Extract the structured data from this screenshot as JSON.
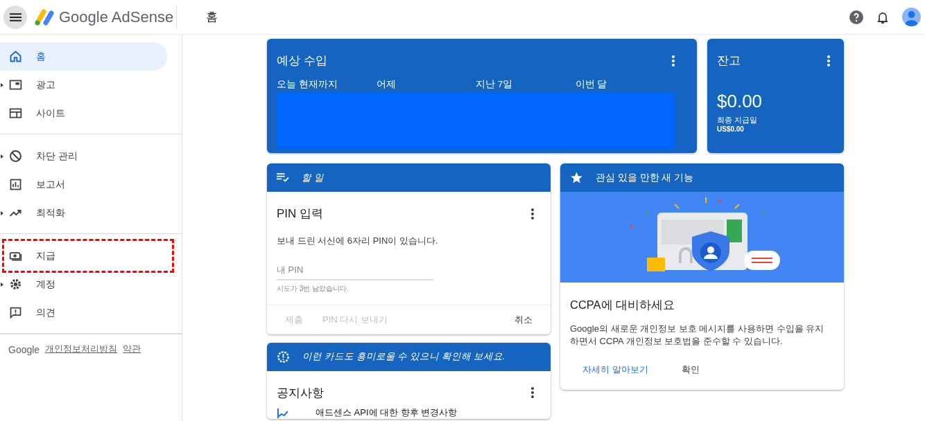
{
  "header": {
    "product": "Google AdSense",
    "page_title": "홈"
  },
  "sidebar": {
    "groups": [
      [
        {
          "label": "홈",
          "selected": true,
          "expandable": false,
          "annotated": false
        },
        {
          "label": "광고",
          "selected": false,
          "expandable": true,
          "annotated": false
        },
        {
          "label": "사이트",
          "selected": false,
          "expandable": false,
          "annotated": false
        }
      ],
      [
        {
          "label": "차단 관리",
          "selected": false,
          "expandable": true,
          "annotated": false
        },
        {
          "label": "보고서",
          "selected": false,
          "expandable": false,
          "annotated": false
        },
        {
          "label": "최적화",
          "selected": false,
          "expandable": true,
          "annotated": false
        }
      ],
      [
        {
          "label": "지급",
          "selected": false,
          "expandable": false,
          "annotated": true
        },
        {
          "label": "계정",
          "selected": false,
          "expandable": true,
          "annotated": false
        },
        {
          "label": "의견",
          "selected": false,
          "expandable": false,
          "annotated": false
        }
      ]
    ],
    "footer": {
      "brand": "Google",
      "links": [
        "개인정보처리방침",
        "약관"
      ]
    }
  },
  "earnings": {
    "title": "예상 수입",
    "columns": [
      "오늘 현재까지",
      "어제",
      "지난 7일",
      "이번 달"
    ]
  },
  "balance": {
    "title": "잔고",
    "amount": "$0.00",
    "last_payment_label": "최종 지급일",
    "last_payment": "US$0.00"
  },
  "todo": {
    "header": "할 일",
    "title": "PIN 입력",
    "text": "보내 드린 서신에 6자리 PIN이 있습니다.",
    "input": {
      "placeholder": "내 PIN",
      "helper": "시도가 3번 남았습니다."
    },
    "actions": [
      {
        "label": "제출",
        "disabled": true
      },
      {
        "label": "PIN 다시 보내기",
        "disabled": true
      },
      {
        "label": "취소",
        "disabled": false
      }
    ]
  },
  "suggestion": {
    "header": "이런 카드도 흥미로울 수 있으니 확인해 보세요.",
    "title": "공지사항",
    "items": [
      "애드센스 API에 대한 향후 변경사항"
    ]
  },
  "feature": {
    "header": "관심 있을 만한 새 기능",
    "title": "CCPA에 대비하세요",
    "text": "Google의 새로운 개인정보 보호 메시지를 사용하면 수입을 유지하면서 CCPA 개인정보 보호법을 준수할 수 있습니다.",
    "actions": [
      {
        "label": "자세히 알아보기",
        "kind": "link"
      },
      {
        "label": "확인",
        "kind": "plain"
      }
    ]
  }
}
